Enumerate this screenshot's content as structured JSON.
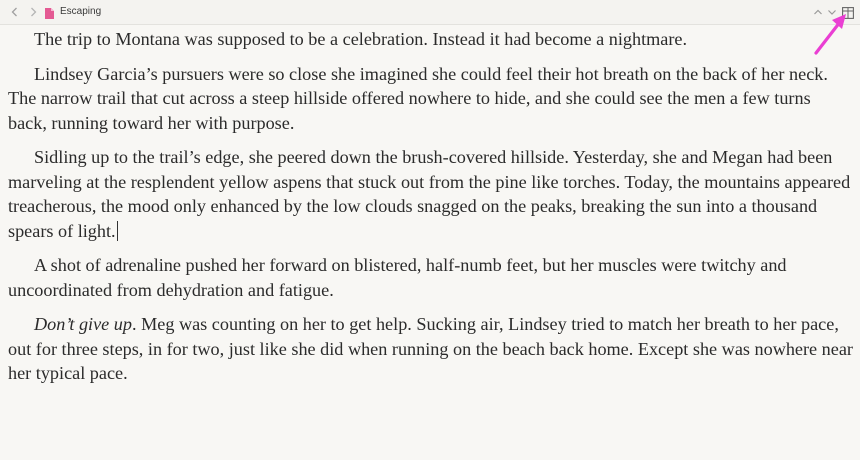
{
  "toolbar": {
    "title": "Escaping",
    "back_icon": "chevron-left-icon",
    "forward_icon": "chevron-right-icon",
    "doc_icon": "document-icon",
    "up_icon": "chevron-up-icon",
    "down_icon": "chevron-down-icon",
    "panel_icon": "sidebar-panel-icon"
  },
  "colors": {
    "background": "#f8f7f4",
    "text": "#2b2b2b",
    "doc_icon": "#e45a93",
    "annotation_arrow": "#ea3fd3"
  },
  "document": {
    "p1": "The trip to Montana was supposed to be a celebration. Instead it had become a nightmare.",
    "p2": "Lindsey Garcia’s pursuers were so close she imagined she could feel their hot breath on the back of her neck. The narrow trail that cut across a steep hillside offered nowhere to hide, and she could see the men a few turns back, running toward her with purpose.",
    "p3": "Sidling up to the trail’s edge, she peered down the brush-covered hillside. Yesterday, she and Megan had been marveling at the resplendent yellow aspens that stuck out from the pine like torches. Today, the mountains appeared treacherous, the mood only enhanced by the low clouds snagged on the peaks, breaking the sun into a thousand spears of light.",
    "p4": "A shot of adrenaline pushed her forward on blistered, half-numb feet, but her muscles were twitchy and uncoordinated from dehydration and fatigue.",
    "p5_italic": "Don’t give up",
    "p5_rest": ". Meg was counting on her to get help. Sucking air, Lindsey tried to match her breath to her pace, out for three steps, in for two, just like she did when running on the beach back home. Except she was nowhere near her typical pace."
  }
}
